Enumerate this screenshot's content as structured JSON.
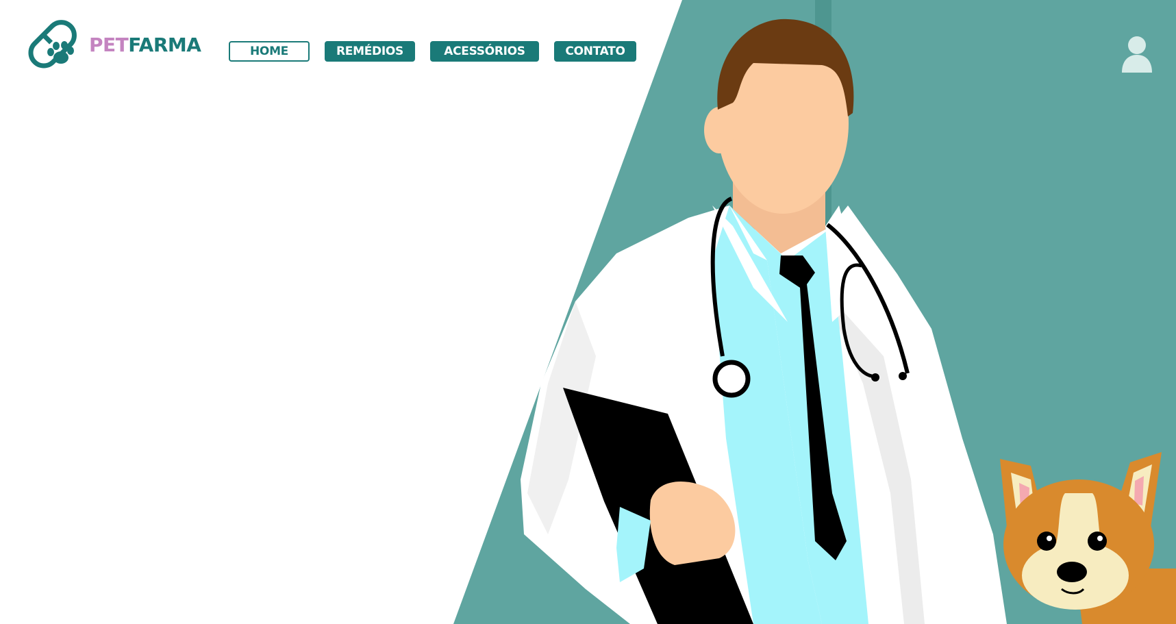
{
  "brand": {
    "name_part1": "PET",
    "name_part2": "FARMA",
    "logo_icon": "pill-paw-logo"
  },
  "nav": {
    "items": [
      {
        "label": "HOME",
        "active": true
      },
      {
        "label": "REMÉDIOS",
        "active": false
      },
      {
        "label": "ACESSÓRIOS",
        "active": false
      },
      {
        "label": "CONTATO",
        "active": false
      }
    ]
  },
  "user_icon": "user-icon",
  "hero": {
    "illustration": "veterinarian-with-dog-illustration"
  },
  "colors": {
    "primary": "#1a7a78",
    "brand_pink": "#c484c0",
    "hero_teal": "#5fa5a0",
    "skin": "#fccba0",
    "shirt": "#a4f4fb"
  }
}
